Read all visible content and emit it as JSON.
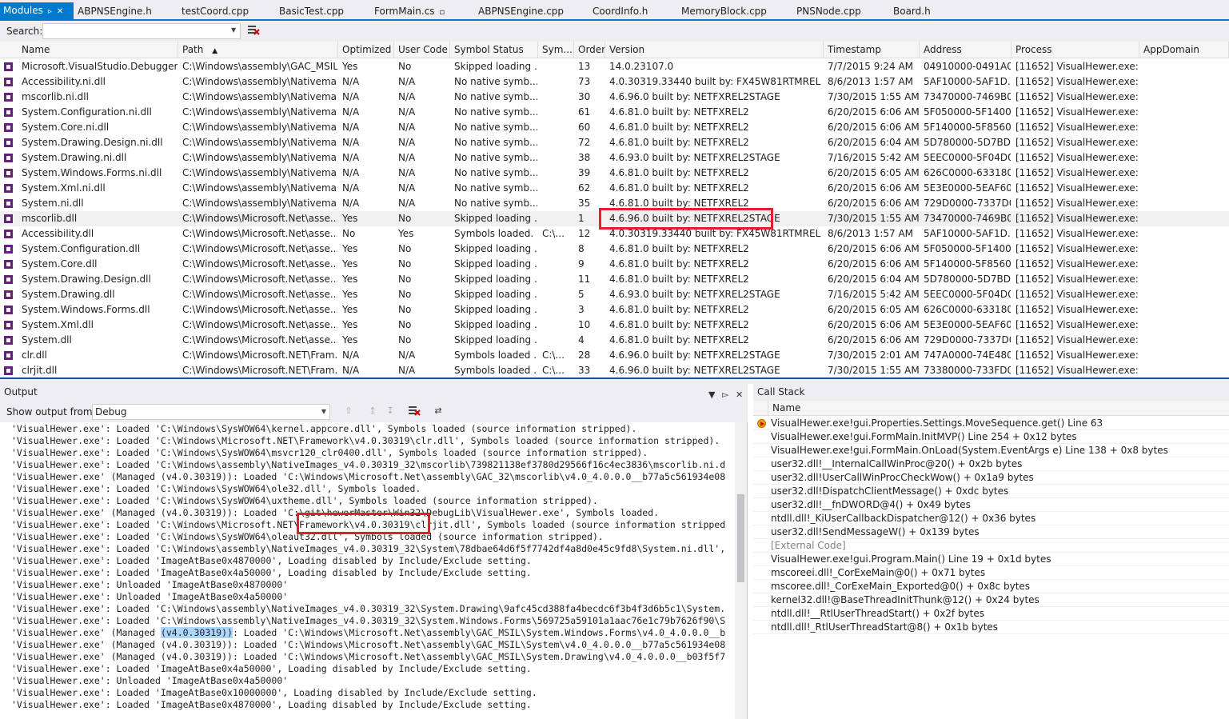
{
  "tabs": [
    {
      "label": "Modules",
      "active": true
    },
    {
      "label": "ABPNSEngine.h"
    },
    {
      "label": "testCoord.cpp"
    },
    {
      "label": "BasicTest.cpp"
    },
    {
      "label": "FormMain.cs"
    },
    {
      "label": "ABPNSEngine.cpp"
    },
    {
      "label": "CoordInfo.h"
    },
    {
      "label": "MemoryBlock.cpp"
    },
    {
      "label": "PNSNode.cpp"
    },
    {
      "label": "Board.h"
    }
  ],
  "search": {
    "label": "Search:",
    "value": ""
  },
  "modules": {
    "columns": [
      "Name",
      "Path",
      "Optimized",
      "User Code",
      "Symbol Status",
      "Sym...",
      "Order",
      "Version",
      "Timestamp",
      "Address",
      "Process",
      "AppDomain"
    ],
    "rows": [
      [
        "Microsoft.VisualStudio.Debugger....",
        "C:\\Windows\\assembly\\GAC_MSIL...",
        "Yes",
        "No",
        "Skipped loading ...",
        "",
        "13",
        "14.0.23107.0",
        "7/7/2015 9:24 AM",
        "04910000-0491A000",
        "[11652] VisualHewer.exe: ...",
        ""
      ],
      [
        "Accessibility.ni.dll",
        "C:\\Windows\\assembly\\Nativema...",
        "N/A",
        "N/A",
        "No native symb...",
        "",
        "73",
        "4.0.30319.33440 built by: FX45W81RTMREL",
        "8/6/2013 1:57 AM",
        "5AF10000-5AF1D...",
        "[11652] VisualHewer.exe: ...",
        ""
      ],
      [
        "mscorlib.ni.dll",
        "C:\\Windows\\assembly\\Nativema...",
        "N/A",
        "N/A",
        "No native symb...",
        "",
        "30",
        "4.6.96.0 built by: NETFXREL2STAGE",
        "7/30/2015 1:55 AM",
        "73470000-7469B000",
        "[11652] VisualHewer.exe: ...",
        ""
      ],
      [
        "System.Configuration.ni.dll",
        "C:\\Windows\\assembly\\Nativema...",
        "N/A",
        "N/A",
        "No native symb...",
        "",
        "61",
        "4.6.81.0 built by: NETFXREL2",
        "6/20/2015 6:06 AM",
        "5F050000-5F140000",
        "[11652] VisualHewer.exe: ...",
        ""
      ],
      [
        "System.Core.ni.dll",
        "C:\\Windows\\assembly\\Nativema...",
        "N/A",
        "N/A",
        "No native symb...",
        "",
        "60",
        "4.6.81.0 built by: NETFXREL2",
        "6/20/2015 6:06 AM",
        "5F140000-5F856000",
        "[11652] VisualHewer.exe: ...",
        ""
      ],
      [
        "System.Drawing.Design.ni.dll",
        "C:\\Windows\\assembly\\Nativema...",
        "N/A",
        "N/A",
        "No native symb...",
        "",
        "72",
        "4.6.81.0 built by: NETFXREL2",
        "6/20/2015 6:04 AM",
        "5D780000-5D7BD...",
        "[11652] VisualHewer.exe: ...",
        ""
      ],
      [
        "System.Drawing.ni.dll",
        "C:\\Windows\\assembly\\Nativema...",
        "N/A",
        "N/A",
        "No native symb...",
        "",
        "38",
        "4.6.93.0 built by: NETFXREL2STAGE",
        "7/16/2015 5:42 AM",
        "5EEC0000-5F04D0...",
        "[11652] VisualHewer.exe: ...",
        ""
      ],
      [
        "System.Windows.Forms.ni.dll",
        "C:\\Windows\\assembly\\Nativema...",
        "N/A",
        "N/A",
        "No native symb...",
        "",
        "39",
        "4.6.81.0 built by: NETFXREL2",
        "6/20/2015 6:05 AM",
        "626C0000-63318000",
        "[11652] VisualHewer.exe: ...",
        ""
      ],
      [
        "System.Xml.ni.dll",
        "C:\\Windows\\assembly\\Nativema...",
        "N/A",
        "N/A",
        "No native symb...",
        "",
        "62",
        "4.6.81.0 built by: NETFXREL2",
        "6/20/2015 6:06 AM",
        "5E3E0000-5EAF6000",
        "[11652] VisualHewer.exe: ...",
        ""
      ],
      [
        "System.ni.dll",
        "C:\\Windows\\assembly\\Nativema...",
        "N/A",
        "N/A",
        "No native symb...",
        "",
        "35",
        "4.6.81.0 built by: NETFXREL2",
        "6/20/2015 6:06 AM",
        "729D0000-7337D0...",
        "[11652] VisualHewer.exe: ...",
        ""
      ],
      [
        "mscorlib.dll",
        "C:\\Windows\\Microsoft.Net\\asse...",
        "Yes",
        "No",
        "Skipped loading ...",
        "",
        "1",
        "4.6.96.0 built by: NETFXREL2STAGE",
        "7/30/2015 1:55 AM",
        "73470000-7469B000",
        "[11652] VisualHewer.exe: ...",
        ""
      ],
      [
        "Accessibility.dll",
        "C:\\Windows\\Microsoft.Net\\asse...",
        "No",
        "Yes",
        "Symbols loaded.",
        "C:\\...",
        "12",
        "4.0.30319.33440 built by: FX45W81RTMREL",
        "8/6/2013 1:57 AM",
        "5AF10000-5AF1D...",
        "[11652] VisualHewer.exe: ...",
        ""
      ],
      [
        "System.Configuration.dll",
        "C:\\Windows\\Microsoft.Net\\asse...",
        "Yes",
        "No",
        "Skipped loading ...",
        "",
        "8",
        "4.6.81.0 built by: NETFXREL2",
        "6/20/2015 6:06 AM",
        "5F050000-5F140000",
        "[11652] VisualHewer.exe: ...",
        ""
      ],
      [
        "System.Core.dll",
        "C:\\Windows\\Microsoft.Net\\asse...",
        "Yes",
        "No",
        "Skipped loading ...",
        "",
        "9",
        "4.6.81.0 built by: NETFXREL2",
        "6/20/2015 6:06 AM",
        "5F140000-5F856000",
        "[11652] VisualHewer.exe: ...",
        ""
      ],
      [
        "System.Drawing.Design.dll",
        "C:\\Windows\\Microsoft.Net\\asse...",
        "Yes",
        "No",
        "Skipped loading ...",
        "",
        "11",
        "4.6.81.0 built by: NETFXREL2",
        "6/20/2015 6:04 AM",
        "5D780000-5D7BD...",
        "[11652] VisualHewer.exe: ...",
        ""
      ],
      [
        "System.Drawing.dll",
        "C:\\Windows\\Microsoft.Net\\asse...",
        "Yes",
        "No",
        "Skipped loading ...",
        "",
        "5",
        "4.6.93.0 built by: NETFXREL2STAGE",
        "7/16/2015 5:42 AM",
        "5EEC0000-5F04D0...",
        "[11652] VisualHewer.exe: ...",
        ""
      ],
      [
        "System.Windows.Forms.dll",
        "C:\\Windows\\Microsoft.Net\\asse...",
        "Yes",
        "No",
        "Skipped loading ...",
        "",
        "3",
        "4.6.81.0 built by: NETFXREL2",
        "6/20/2015 6:05 AM",
        "626C0000-63318000",
        "[11652] VisualHewer.exe: ...",
        ""
      ],
      [
        "System.Xml.dll",
        "C:\\Windows\\Microsoft.Net\\asse...",
        "Yes",
        "No",
        "Skipped loading ...",
        "",
        "10",
        "4.6.81.0 built by: NETFXREL2",
        "6/20/2015 6:06 AM",
        "5E3E0000-5EAF6000",
        "[11652] VisualHewer.exe: ...",
        ""
      ],
      [
        "System.dll",
        "C:\\Windows\\Microsoft.Net\\asse...",
        "Yes",
        "No",
        "Skipped loading ...",
        "",
        "4",
        "4.6.81.0 built by: NETFXREL2",
        "6/20/2015 6:06 AM",
        "729D0000-7337D0...",
        "[11652] VisualHewer.exe: ...",
        ""
      ],
      [
        "clr.dll",
        "C:\\Windows\\Microsoft.NET\\Fram...",
        "N/A",
        "N/A",
        "Symbols loaded ...",
        "C:\\...",
        "28",
        "4.6.96.0 built by: NETFXREL2STAGE",
        "7/30/2015 2:01 AM",
        "747A0000-74E48000",
        "[11652] VisualHewer.exe: ...",
        ""
      ],
      [
        "clrjit.dll",
        "C:\\Windows\\Microsoft.NET\\Fram...",
        "N/A",
        "N/A",
        "Symbols loaded ...",
        "C:\\...",
        "33",
        "4.6.96.0 built by: NETFXREL2STAGE",
        "7/30/2015 1:55 AM",
        "73380000-733FD000",
        "[11652] VisualHewer.exe: ...",
        ""
      ]
    ]
  },
  "output": {
    "title": "Output",
    "show_label": "Show output from:",
    "show_value": "Debug",
    "lines": [
      "'VisualHewer.exe': Loaded 'C:\\Windows\\SysWOW64\\kernel.appcore.dll', Symbols loaded (source information stripped).",
      "'VisualHewer.exe': Loaded 'C:\\Windows\\Microsoft.NET\\Framework\\v4.0.30319\\clr.dll', Symbols loaded (source information stripped).",
      "'VisualHewer.exe': Loaded 'C:\\Windows\\SysWOW64\\msvcr120_clr0400.dll', Symbols loaded (source information stripped).",
      "'VisualHewer.exe': Loaded 'C:\\Windows\\assembly\\NativeImages_v4.0.30319_32\\mscorlib\\739821138ef3780d29566f16c4ec3836\\mscorlib.ni.d",
      "'VisualHewer.exe' (Managed (v4.0.30319)): Loaded 'C:\\Windows\\Microsoft.Net\\assembly\\GAC_32\\mscorlib\\v4.0_4.0.0.0__b77a5c561934e08",
      "'VisualHewer.exe': Loaded 'C:\\Windows\\SysWOW64\\ole32.dll', Symbols loaded.",
      "'VisualHewer.exe': Loaded 'C:\\Windows\\SysWOW64\\uxtheme.dll', Symbols loaded (source information stripped).",
      "'VisualHewer.exe' (Managed (v4.0.30319)): Loaded 'C:\\git\\hewerMaster\\Win32\\DebugLib\\VisualHewer.exe', Symbols loaded.",
      "'VisualHewer.exe': Loaded 'C:\\Windows\\Microsoft.NET\\Framework\\v4.0.30319\\clrjit.dll', Symbols loaded (source information stripped",
      "'VisualHewer.exe': Loaded 'C:\\Windows\\SysWOW64\\oleaut32.dll', Symbols loaded (source information stripped).",
      "'VisualHewer.exe': Loaded 'C:\\Windows\\assembly\\NativeImages_v4.0.30319_32\\System\\78dbae64d6f5f7742df4a8d0e45c9fd8\\System.ni.dll',",
      "'VisualHewer.exe': Loaded 'ImageAtBase0x4870000', Loading disabled by Include/Exclude setting.",
      "'VisualHewer.exe': Loaded 'ImageAtBase0x4a50000', Loading disabled by Include/Exclude setting.",
      "'VisualHewer.exe': Unloaded 'ImageAtBase0x4870000'",
      "'VisualHewer.exe': Unloaded 'ImageAtBase0x4a50000'",
      "'VisualHewer.exe': Loaded 'C:\\Windows\\assembly\\NativeImages_v4.0.30319_32\\System.Drawing\\9afc45cd388fa4becdc6f3b4f3d6b5c1\\System.",
      "'VisualHewer.exe': Loaded 'C:\\Windows\\assembly\\NativeImages_v4.0.30319_32\\System.Windows.Forms\\569725a59101a1aac76e1c79b7626f90\\S",
      "'VisualHewer.exe' (Managed (v4.0.30319)): Loaded 'C:\\Windows\\Microsoft.Net\\assembly\\GAC_MSIL\\System.Windows.Forms\\v4.0_4.0.0.0__b",
      "'VisualHewer.exe' (Managed (v4.0.30319)): Loaded 'C:\\Windows\\Microsoft.Net\\assembly\\GAC_MSIL\\System\\v4.0_4.0.0.0__b77a5c561934e08",
      "'VisualHewer.exe' (Managed (v4.0.30319)): Loaded 'C:\\Windows\\Microsoft.Net\\assembly\\GAC_MSIL\\System.Drawing\\v4.0_4.0.0.0__b03f5f7",
      "'VisualHewer.exe': Loaded 'ImageAtBase0x4a50000', Loading disabled by Include/Exclude setting.",
      "'VisualHewer.exe': Unloaded 'ImageAtBase0x4a50000'",
      "'VisualHewer.exe': Loaded 'ImageAtBase0x10000000', Loading disabled by Include/Exclude setting.",
      "'VisualHewer.exe': Loaded 'ImageAtBase0x4870000', Loading disabled by Include/Exclude setting."
    ]
  },
  "callstack": {
    "title": "Call Stack",
    "column": "Name",
    "frames": [
      {
        "text": "VisualHewer.exe!gui.Properties.Settings.MoveSequence.get() Line 63",
        "current": true
      },
      {
        "text": "VisualHewer.exe!gui.FormMain.InitMVP() Line 254 + 0x12 bytes"
      },
      {
        "text": "VisualHewer.exe!gui.FormMain.OnLoad(System.EventArgs e) Line 138 + 0x8 bytes"
      },
      {
        "text": "user32.dll!__InternalCallWinProc@20() + 0x2b bytes"
      },
      {
        "text": "user32.dll!UserCallWinProcCheckWow() + 0x1a9 bytes"
      },
      {
        "text": "user32.dll!DispatchClientMessage() + 0xdc bytes"
      },
      {
        "text": "user32.dll!__fnDWORD@4() + 0x49 bytes"
      },
      {
        "text": "ntdll.dll!_KiUserCallbackDispatcher@12() + 0x36 bytes"
      },
      {
        "text": "user32.dll!SendMessageW() + 0x139 bytes"
      },
      {
        "text": "[External Code]",
        "external": true
      },
      {
        "text": "VisualHewer.exe!gui.Program.Main() Line 19 + 0x1d bytes"
      },
      {
        "text": "mscoreei.dll!_CorExeMain@0() + 0x71 bytes"
      },
      {
        "text": "mscoree.dll!_CorExeMain_Exported@0() + 0x8c bytes"
      },
      {
        "text": "kernel32.dll!@BaseThreadInitThunk@12() + 0x24 bytes"
      },
      {
        "text": "ntdll.dll!__RtlUserThreadStart() + 0x2f bytes"
      },
      {
        "text": "ntdll.dll!_RtlUserThreadStart@8() + 0x1b bytes"
      }
    ]
  },
  "colors": {
    "accent": "#007acc",
    "module_icon": "#68217a",
    "annotation": "#e0202a"
  }
}
